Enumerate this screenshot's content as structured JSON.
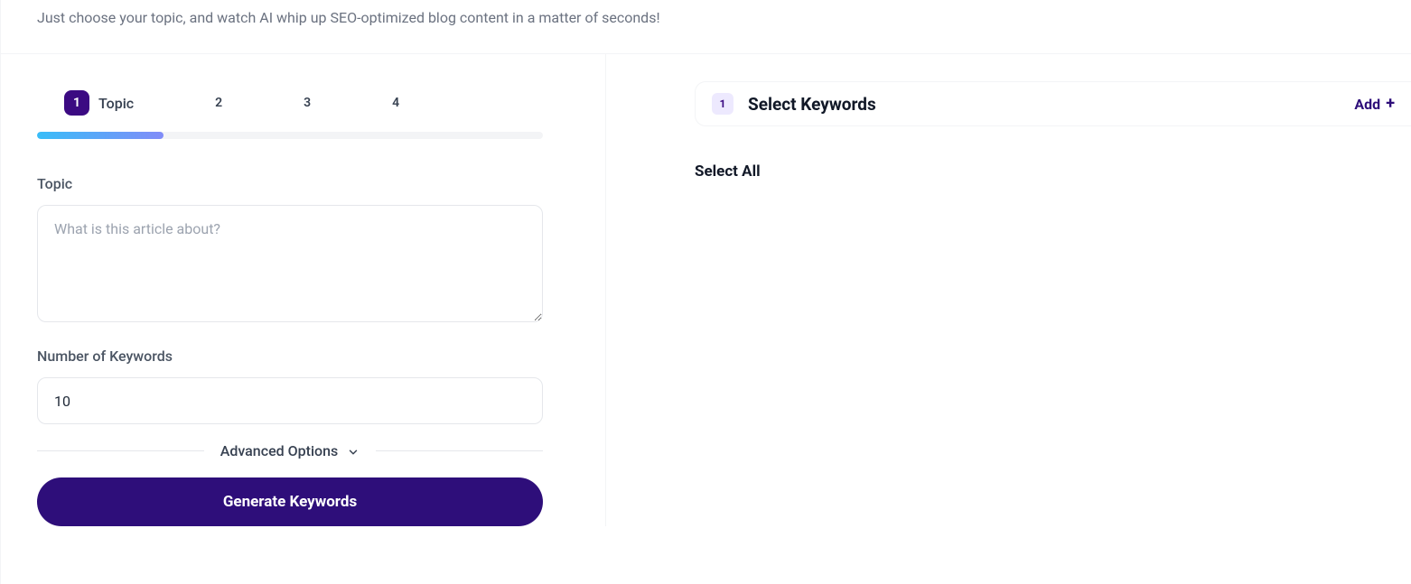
{
  "intro": "Just choose your topic, and watch AI whip up SEO-optimized blog content in a matter of seconds!",
  "stepper": {
    "steps": [
      {
        "num": "1",
        "label": "Topic",
        "active": true
      },
      {
        "num": "2",
        "label": "",
        "active": false
      },
      {
        "num": "3",
        "label": "",
        "active": false
      },
      {
        "num": "4",
        "label": "",
        "active": false
      }
    ]
  },
  "form": {
    "topic_label": "Topic",
    "topic_placeholder": "What is this article about?",
    "topic_value": "",
    "num_label": "Number of Keywords",
    "num_value": "10",
    "advanced_label": "Advanced Options",
    "generate_label": "Generate Keywords"
  },
  "keywords_panel": {
    "badge": "1",
    "title": "Select Keywords",
    "add_label": "Add",
    "select_all_label": "Select All"
  }
}
